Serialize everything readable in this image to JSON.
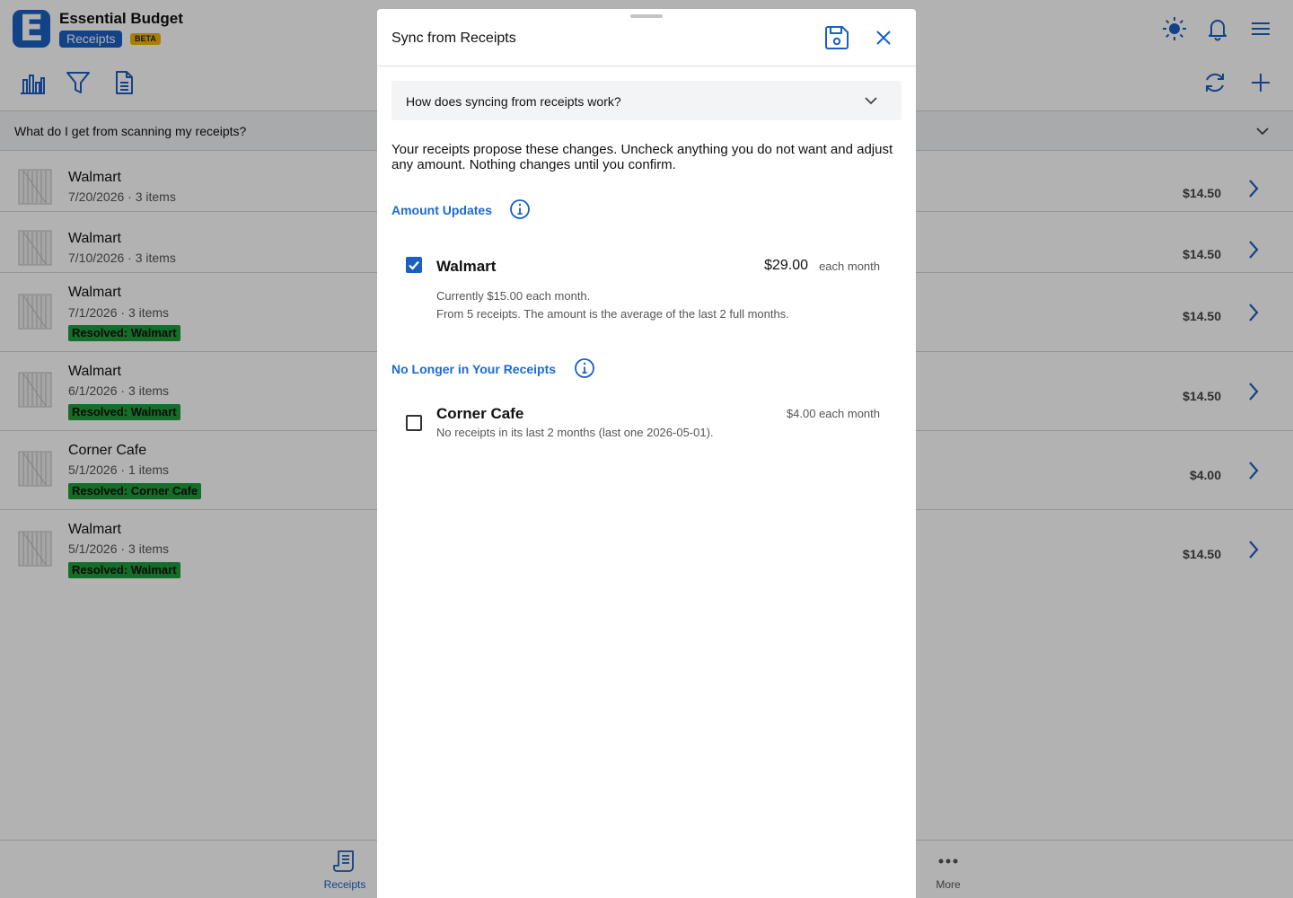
{
  "app": {
    "title": "Essential Budget",
    "logo_letter": "E",
    "section_pill": "Receipts",
    "beta_pill": "BETA"
  },
  "faq": {
    "question": "What do I get from scanning my receipts?"
  },
  "rows": [
    {
      "merchant": "Walmart",
      "meta": "7/20/2026 · 3 items",
      "badge": "",
      "amount": "$14.50"
    },
    {
      "merchant": "Walmart",
      "meta": "7/10/2026 · 3 items",
      "badge": "",
      "amount": "$14.50"
    },
    {
      "merchant": "Walmart",
      "meta": "7/1/2026 · 3 items",
      "badge": "Resolved: Walmart",
      "amount": "$14.50"
    },
    {
      "merchant": "Walmart",
      "meta": "6/1/2026 · 3 items",
      "badge": "Resolved: Walmart",
      "amount": "$14.50"
    },
    {
      "merchant": "Corner Cafe",
      "meta": "5/1/2026 · 1 items",
      "badge": "Resolved: Corner Cafe",
      "amount": "$4.00"
    },
    {
      "merchant": "Walmart",
      "meta": "5/1/2026 · 3 items",
      "badge": "Resolved: Walmart",
      "amount": "$14.50"
    }
  ],
  "tabbar": {
    "receipts": "Receipts",
    "more": "More"
  },
  "sheet": {
    "title": "Sync from Receipts",
    "howto": "How does syncing from receipts work?",
    "intro": "Your receipts propose these changes. Uncheck anything you do not want and adjust any amount. Nothing changes until you confirm.",
    "amount_updates": {
      "title": "Amount Updates",
      "item": {
        "checked": true,
        "name": "Walmart",
        "amount": "$29.00",
        "per": "each month",
        "note1": "Currently $15.00 each month.",
        "note2": "From 5 receipts. The amount is the average of the last 2 full months."
      }
    },
    "no_longer": {
      "title": "No Longer in Your Receipts",
      "item": {
        "checked": false,
        "name": "Corner Cafe",
        "amount": "$4.00 each month",
        "note": "No receipts in its last 2 months (last one 2026-05-01)."
      }
    }
  },
  "colors": {
    "accent": "#1b5fc2",
    "link": "#1b6ad4",
    "badge_green": "#1e9d3a",
    "beta_yellow": "#f2b705"
  }
}
